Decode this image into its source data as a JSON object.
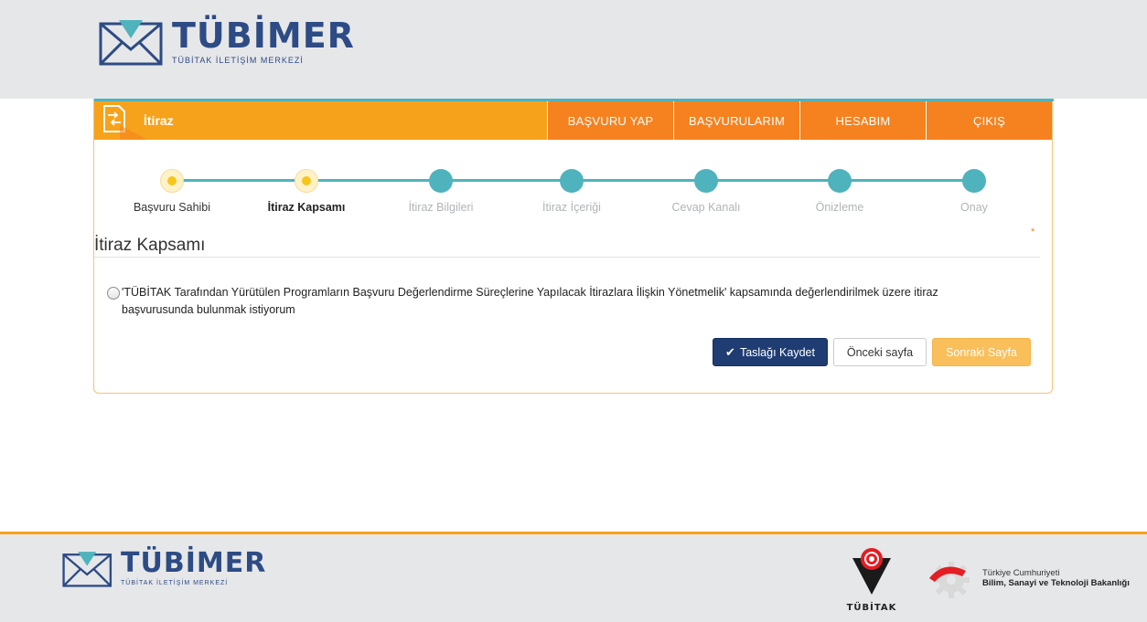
{
  "header": {
    "brand": "TÜBİMER",
    "subtitle": "TÜBİTAK İLETİŞİM MERKEZİ"
  },
  "menubar": {
    "title": "İtiraz",
    "nav": [
      "BAŞVURU YAP",
      "BAŞVURULARIM",
      "HESABIM",
      "ÇIKIŞ"
    ]
  },
  "steps": [
    {
      "label": "Başvuru Sahibi",
      "state": "done"
    },
    {
      "label": "İtiraz Kapsamı",
      "state": "current"
    },
    {
      "label": "İtiraz Bilgileri",
      "state": "pending"
    },
    {
      "label": "İtiraz İçeriği",
      "state": "pending"
    },
    {
      "label": "Cevap Kanalı",
      "state": "pending"
    },
    {
      "label": "Önizleme",
      "state": "pending"
    },
    {
      "label": "Onay",
      "state": "pending"
    }
  ],
  "section": {
    "title": "İtiraz Kapsamı",
    "required_mark": "*",
    "option_text": "'TÜBİTAK Tarafından Yürütülen Programların Başvuru Değerlendirme Süreçlerine Yapılacak İtirazlara İlişkin Yönetmelik' kapsamında değerlendirilmek üzere itiraz başvurusunda bulunmak istiyorum"
  },
  "buttons": {
    "save": "Taslağı Kaydet",
    "prev": "Önceki sayfa",
    "next": "Sonraki Sayfa"
  },
  "footer": {
    "brand": "TÜBİMER",
    "subtitle": "TÜBİTAK İLETİŞİM MERKEZİ",
    "tubitak": "TÜBİTAK",
    "ministry_line1": "Türkiye Cumhuriyeti",
    "ministry_line2": "Bilim, Sanayi ve Teknoloji Bakanlığı"
  },
  "colors": {
    "orange": "#f7a21b",
    "dark_orange": "#f5821f",
    "teal": "#4eb3bd",
    "navy": "#1f3d73",
    "brand_blue": "#2d4b84"
  }
}
